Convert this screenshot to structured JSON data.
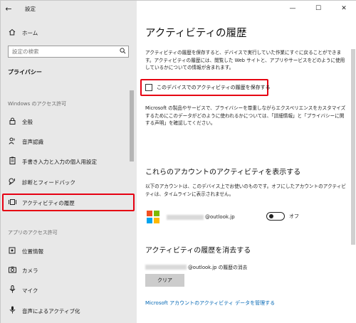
{
  "window": {
    "app_title": "設定",
    "controls": {
      "minimize": "—",
      "maximize": "☐",
      "close": "✕"
    }
  },
  "sidebar": {
    "back_glyph": "←",
    "home": {
      "icon": "home-icon",
      "label": "ホーム"
    },
    "search": {
      "placeholder": "設定の検索"
    },
    "section_title": "プライバシー",
    "groups": [
      {
        "heading": "Windows のアクセス許可",
        "items": [
          {
            "icon": "lock-icon",
            "label": "全般"
          },
          {
            "icon": "person-voice-icon",
            "label": "音声認識"
          },
          {
            "icon": "clipboard-icon",
            "label": "手書き入力と入力の個人用設定"
          },
          {
            "icon": "feedback-icon",
            "label": "診断とフィードバック"
          },
          {
            "icon": "timeline-icon",
            "label": "アクティビティの履歴",
            "selected": true
          }
        ]
      },
      {
        "heading": "アプリのアクセス許可",
        "items": [
          {
            "icon": "location-icon",
            "label": "位置情報"
          },
          {
            "icon": "camera-icon",
            "label": "カメラ"
          },
          {
            "icon": "microphone-icon",
            "label": "マイク"
          },
          {
            "icon": "voice-activation-icon",
            "label": "音声によるアクティブ化"
          }
        ]
      }
    ]
  },
  "main": {
    "title": "アクティビティの履歴",
    "intro": "アクティビティの履歴を保存すると、デバイスで実行していた作業にすぐに戻ることができます。アクティビティの履歴には、閲覧した Web サイトと、アプリやサービスをどのように使用しているかについての情報が含まれます。",
    "store_checkbox": {
      "label": "このデバイスでのアクティビティの履歴を保存する",
      "checked": false
    },
    "privacy_note": "Microsoft の製品やサービスで、プライバシーを尊重しながらエクスペリエンスをカスタマイズするためにこのデータがどのように使われるかについては、「詳細情報」と「プライバシーに関する声明」を確認してください。",
    "show_accounts": {
      "heading": "これらのアカウントのアクティビティを表示する",
      "description": "以下のアカウントは、このデバイス上でお使いのものです。オフにしたアカウントのアクティビティは、タイムラインに表示されません。",
      "account_email_suffix": "@outlook.jp",
      "toggle_label": "オフ",
      "toggle_on": false
    },
    "clear": {
      "heading": "アクティビティの履歴を消去する",
      "line_suffix": "@outlook.jp の履歴の消去",
      "button": "クリア"
    },
    "manage_link": "Microsoft アカウントのアクティビティ データを管理する"
  },
  "colors": {
    "highlight": "#e60012",
    "link": "#0066b4",
    "ms_logo": [
      "#f25022",
      "#7fba00",
      "#00a4ef",
      "#ffb900"
    ]
  }
}
